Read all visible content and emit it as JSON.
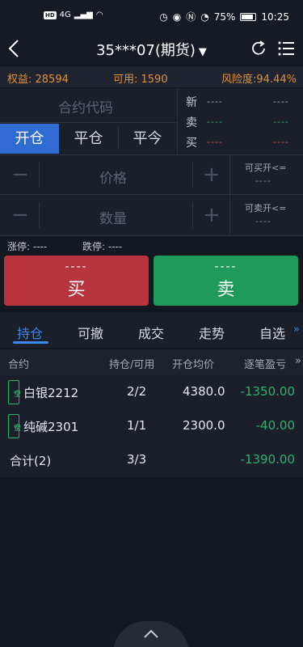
{
  "status_bar": {
    "network": "4G",
    "battery": "75%",
    "time": "10:25"
  },
  "nav": {
    "title": "35***07(期货)",
    "caret": "▼"
  },
  "account": {
    "equity_label": "权益: 28594",
    "available_label": "可用: 1590",
    "risk_label": "风险度:94.44%"
  },
  "order_form": {
    "contract_placeholder": "合约代码",
    "tabs": [
      "开仓",
      "平仓",
      "平今"
    ],
    "price_placeholder": "价格",
    "qty_placeholder": "数量",
    "minus": "−",
    "plus": "+"
  },
  "quote": {
    "new_label": "新",
    "sell_label": "卖",
    "buy_label": "买",
    "dash": "----"
  },
  "capacity": {
    "can_buy_label": "可买开<=",
    "can_sell_label": "可卖开<=",
    "dash": "----"
  },
  "limits": {
    "limit_up": "涨停: ----",
    "limit_down": "跌停: ----"
  },
  "buttons": {
    "buy_top": "----",
    "buy": "买",
    "sell_top": "----",
    "sell": "卖"
  },
  "tabs": [
    "持仓",
    "可撤",
    "成交",
    "走势",
    "自选"
  ],
  "table": {
    "headers": [
      "合约",
      "持仓/可用",
      "开仓均价",
      "逐笔盈亏"
    ],
    "rows": [
      {
        "badge_top": "空",
        "badge_bottom": "今",
        "contract": "白银2212",
        "position": "2/2",
        "avg_price": "4380.0",
        "pnl": "-1350.00"
      },
      {
        "badge_top": "空",
        "badge_bottom": "仓",
        "contract": "纯碱2301",
        "position": "1/1",
        "avg_price": "2300.0",
        "pnl": "-40.00"
      }
    ],
    "total": {
      "label": "合计(2)",
      "position": "3/3",
      "pnl": "-1390.00"
    }
  },
  "colors": {
    "accent_blue": "#2f6bd0",
    "buy_red": "#b8343c",
    "sell_green": "#1f9a5a",
    "profit_green": "#2db36b",
    "account_orange": "#e0923a"
  }
}
